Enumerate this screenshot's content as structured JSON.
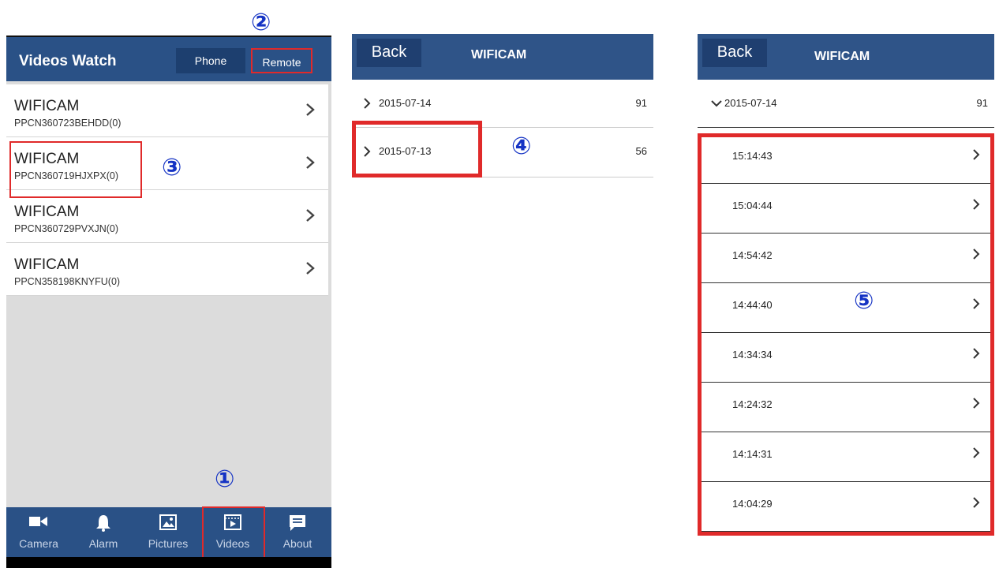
{
  "callouts": {
    "c1": "①",
    "c2": "②",
    "c3": "③",
    "c4": "④",
    "c5": "⑤"
  },
  "videos_screen": {
    "title": "Videos Watch",
    "phone_label": "Phone",
    "remote_label": "Remote",
    "cameras": [
      {
        "name": "WIFICAM",
        "id": "PPCN360723BEHDD(0)"
      },
      {
        "name": "WIFICAM",
        "id": "PPCN360719HJXPX(0)"
      },
      {
        "name": "WIFICAM",
        "id": "PPCN360729PVXJN(0)"
      },
      {
        "name": "WIFICAM",
        "id": "PPCN358198KNYFU(0)"
      }
    ],
    "tabs": [
      {
        "label": "Camera",
        "icon": "camera-icon"
      },
      {
        "label": "Alarm",
        "icon": "bell-icon"
      },
      {
        "label": "Pictures",
        "icon": "picture-icon"
      },
      {
        "label": "Videos",
        "icon": "video-icon"
      },
      {
        "label": "About",
        "icon": "message-icon"
      }
    ]
  },
  "dates_screen": {
    "back_label": "Back",
    "title": "WIFICAM",
    "dates": [
      {
        "date": "2015-07-14",
        "count": "91"
      },
      {
        "date": "2015-07-13",
        "count": "56"
      }
    ]
  },
  "times_screen": {
    "back_label": "Back",
    "title": "WIFICAM",
    "expanded_date": "2015-07-14",
    "expanded_count": "91",
    "times": [
      "15:14:43",
      "15:04:44",
      "14:54:42",
      "14:44:40",
      "14:34:34",
      "14:24:32",
      "14:14:31",
      "14:04:29"
    ]
  },
  "colors": {
    "header_blue": "#2a5186",
    "highlight_red": "#e02a2a",
    "callout_blue": "#1533c4"
  }
}
